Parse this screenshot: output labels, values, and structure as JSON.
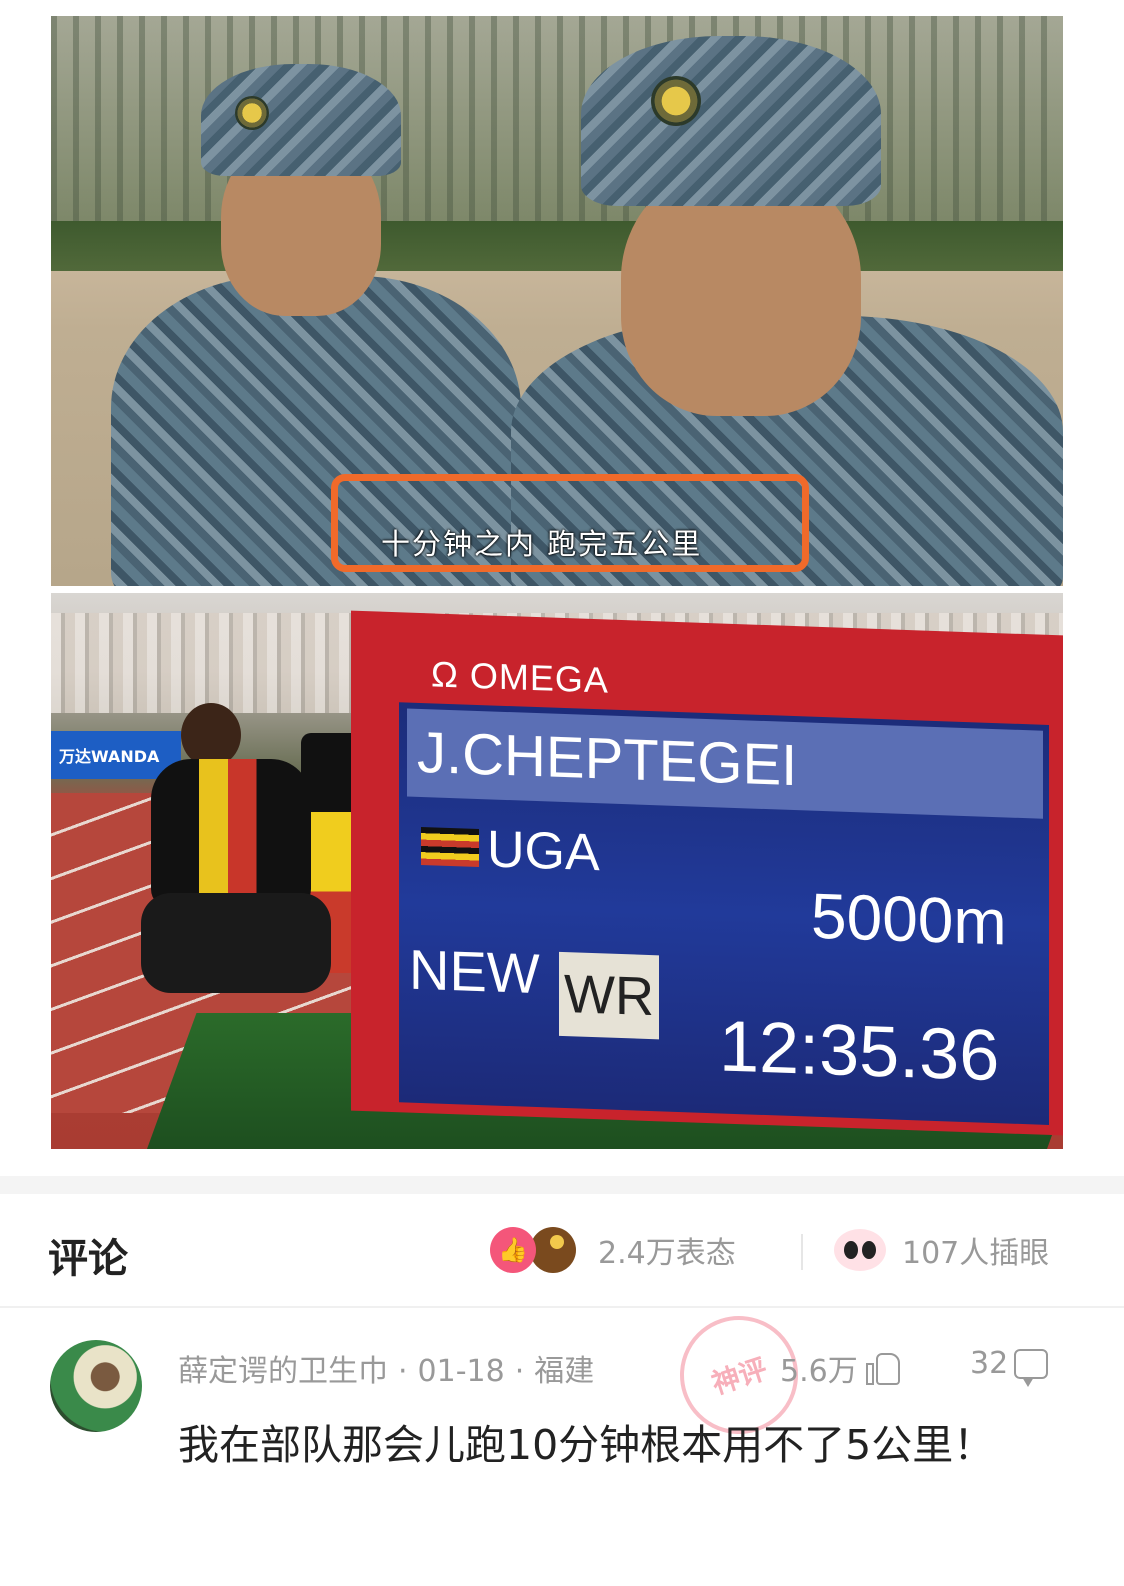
{
  "photos": {
    "top": {
      "caption": "十分钟之内 跑完五公里"
    },
    "bottom": {
      "brand": "Ω OMEGA",
      "banner": "万达WANDA",
      "athlete_name": "J.CHEPTEGEI",
      "country": "UGA",
      "event": "5000m",
      "prefix": "NEW",
      "record_type": "WR",
      "time": "12:35.36"
    }
  },
  "comments": {
    "title": "评论",
    "reactions": {
      "count": "2.4万表态",
      "icons": [
        "like-icon",
        "surprised-face-icon"
      ]
    },
    "onlookers": {
      "count": "107人插眼",
      "icon": "eyes-icon"
    },
    "items": [
      {
        "author": "薛定谔的卫生巾",
        "date": "01-18",
        "location": "福建",
        "stamp": "神评",
        "likes": "5.6万",
        "replies": "32",
        "text": "我在部队那会儿跑10分钟根本用不了5公里！"
      }
    ]
  },
  "colors": {
    "accent_orange": "#f06a2a",
    "like_pink": "#f4567a",
    "meta_gray": "#999999"
  }
}
